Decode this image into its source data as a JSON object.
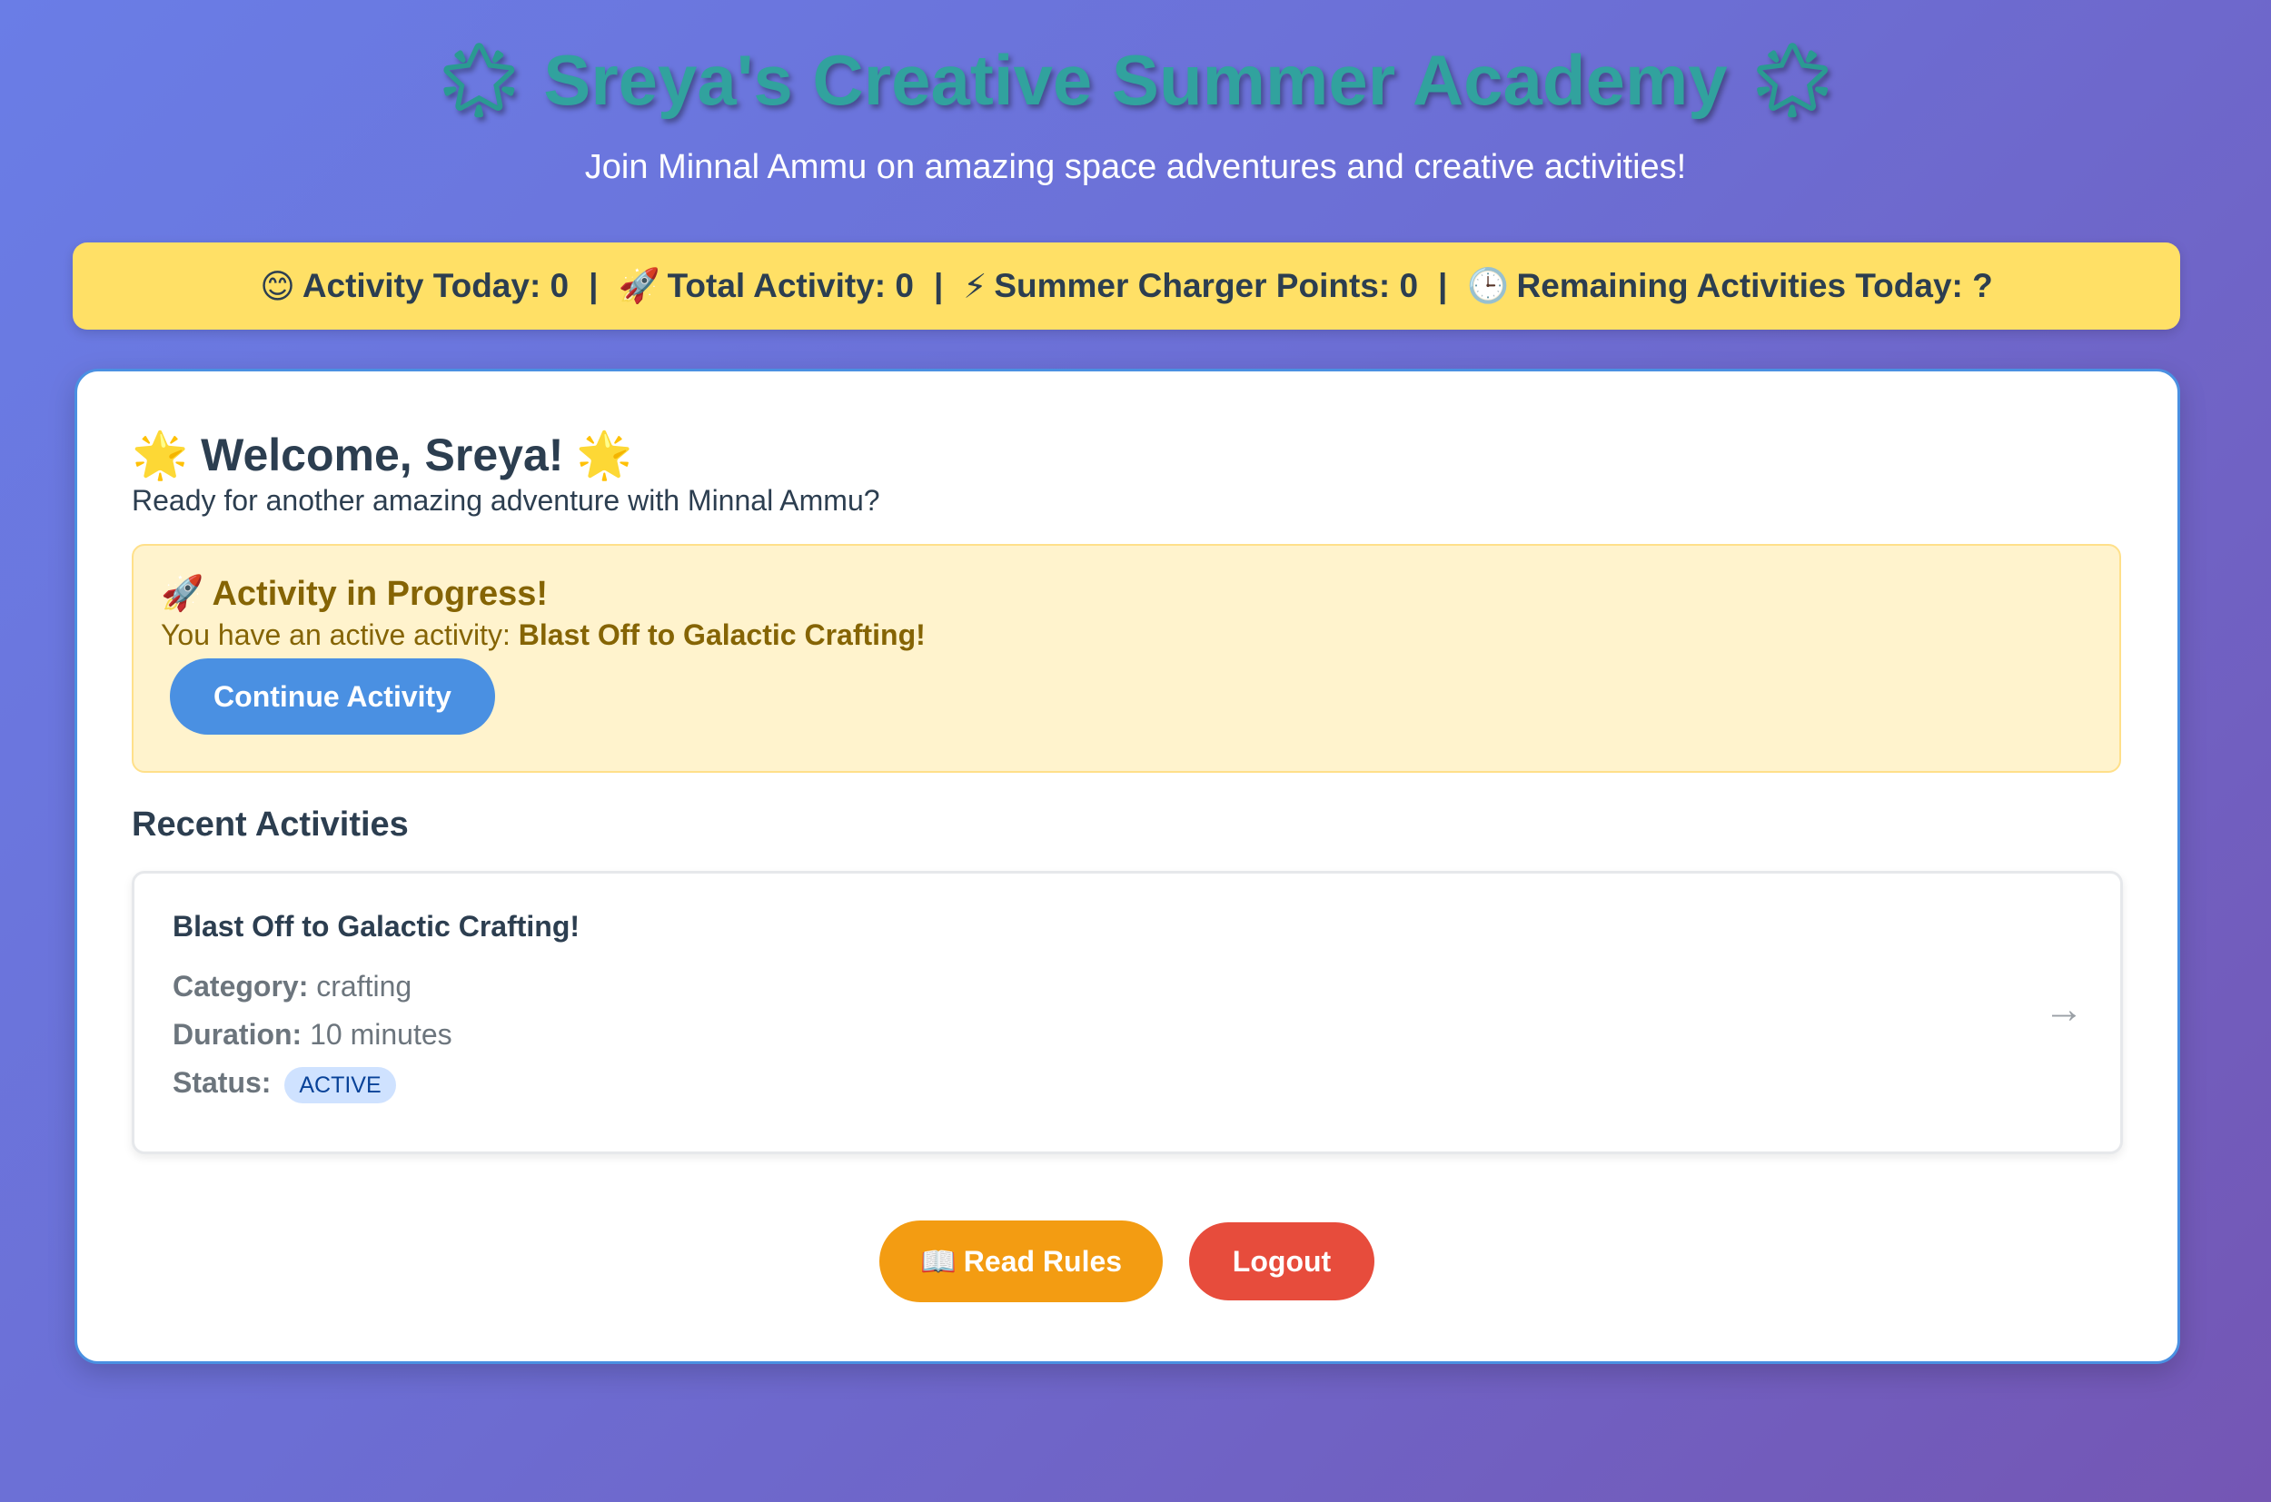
{
  "header": {
    "title": "Sreya's Creative Summer Academy",
    "title_icon": "star-icon",
    "subtitle": "Join Minnal Ammu on amazing space adventures and creative activities!"
  },
  "stats": {
    "activity_today_label": "Activity Today: 0",
    "activity_today_icon": "smiley-icon",
    "total_activity_label": "Total Activity: 0",
    "total_activity_icon": "rocket-icon",
    "charger_points_label": "Summer Charger Points: 0",
    "charger_points_icon": "lightning-icon",
    "remaining_label": "Remaining Activities Today: ?",
    "remaining_icon": "clock-icon",
    "separator": "|"
  },
  "welcome": {
    "title": "Welcome, Sreya!",
    "title_icon": "glowing-star-icon",
    "subtitle": "Ready for another amazing adventure with Minnal Ammu?"
  },
  "in_progress": {
    "title": "Activity in Progress!",
    "title_icon": "rocket-icon",
    "text_prefix": "You have an active activity:",
    "activity_name": "Blast Off to Galactic Crafting!",
    "button_label": "Continue Activity"
  },
  "recent": {
    "heading": "Recent Activities",
    "items": [
      {
        "name": "Blast Off to Galactic Crafting!",
        "category_label": "Category:",
        "category": "crafting",
        "duration_label": "Duration:",
        "duration": "10 minutes",
        "status_label": "Status:",
        "status": "ACTIVE",
        "arrow": "→"
      }
    ]
  },
  "footer": {
    "rules_label": "Read Rules",
    "rules_icon": "book-icon",
    "logout_label": "Logout"
  },
  "colors": {
    "accent_blue": "#4a90e2",
    "stats_yellow": "#ffe066",
    "rules_orange": "#f39c12",
    "logout_red": "#e74c3c",
    "title_teal": "#31a29e"
  }
}
